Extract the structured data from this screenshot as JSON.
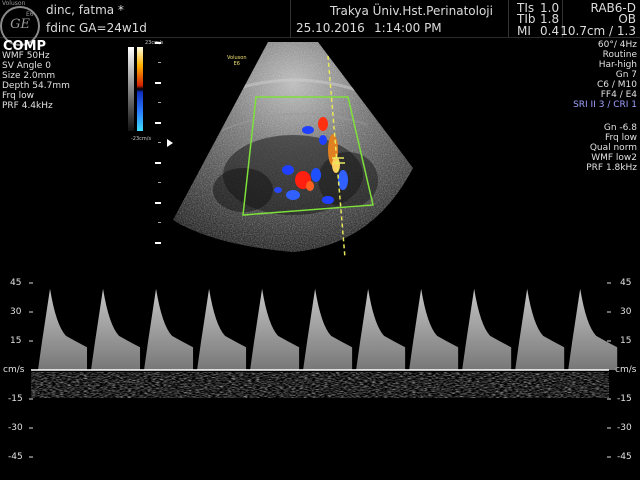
{
  "header": {
    "patient_name": "dinc, fatma  *",
    "patient_id": "fdinc",
    "gestational_age": "GA=24w1d",
    "institution": "Trakya Üniv.Hst.Perinatoloji",
    "date": "25.10.2016",
    "time": "1:14:00 PM",
    "logo_text": "GE",
    "brand": "Voluson",
    "brand_model": "E6",
    "tis_label": "TIs",
    "tis_value": "1.0",
    "tib_label": "TIb",
    "tib_value": "1.8",
    "mi_label": "MI",
    "mi_value": "0.4",
    "probe": "RAB6-D",
    "preset": "OB",
    "depth_freq": "10.7cm / 1.3"
  },
  "left_panel": {
    "mode": "COMP",
    "lines": [
      "WMF 50Hz",
      "SV Angle  0",
      "Size  2.0mm",
      "Depth 54.7mm",
      "Frq low",
      "PRF  4.4kHz"
    ]
  },
  "colorbar": {
    "top_label": "23cm/s",
    "bottom_label": "-23cm/s",
    "colors": [
      "#ffffe0",
      "#ffb000",
      "#d02000",
      "#1030c0",
      "#2a80ff",
      "#40e0ff"
    ]
  },
  "image_overlay": {
    "brand": "Voluson",
    "model": "E6"
  },
  "right_panel": {
    "lines": [
      "60°/ 4Hz",
      "Routine",
      "Har-high",
      "Gn  7",
      "C6 / M10",
      "FF4 / E4"
    ],
    "sri_line": "SRI II 3 / CRI 1",
    "doppler_lines": [
      "Gn -6.8",
      "Frq low",
      "Qual norm",
      "WMF low2",
      "PRF  1.8kHz"
    ]
  },
  "spectral": {
    "unit": "cm/s",
    "ticks_left": [
      "45",
      "30",
      "15",
      "-15",
      "-30",
      "-45"
    ],
    "ticks_right": [
      "45",
      "30",
      "15",
      "-15",
      "-30",
      "-45"
    ],
    "peak_count": 11,
    "peak_velocity_cm_s": 42,
    "baseline_color": "#ffffff"
  }
}
